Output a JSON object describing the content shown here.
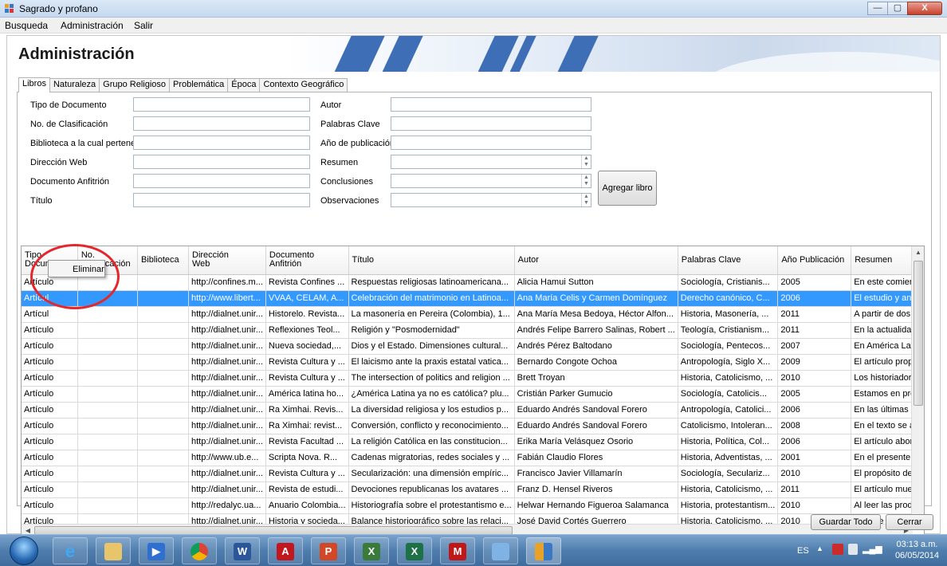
{
  "window": {
    "title": "Sagrado y profano",
    "controls": [
      "—",
      "▢",
      "X"
    ]
  },
  "menu": [
    "Busqueda",
    "Administración",
    "Salir"
  ],
  "page": {
    "heading": "Administración"
  },
  "tabs": [
    "Libros",
    "Naturaleza",
    "Grupo Religioso",
    "Problemática",
    "Época",
    "Contexto Geográfico"
  ],
  "form": {
    "left_labels": [
      "Tipo de Documento",
      "No. de Clasificación",
      "Biblioteca a la cual pertenece",
      "Dirección Web",
      "Documento Anfitrión",
      "Título"
    ],
    "right_labels": [
      "Autor",
      "Palabras Clave",
      "Año de publicación",
      "Resumen",
      "Conclusiones",
      "Observaciones"
    ],
    "add_button": "Agregar libro"
  },
  "grid": {
    "columns": [
      "Tipo\nDocumento",
      "No.\nClasificación",
      "Biblioteca",
      "Dirección\nWeb",
      "Documento\nAnfitrión",
      "Título",
      "Autor",
      "Palabras Clave",
      "Año Publicación",
      "Resumen"
    ],
    "rows": [
      [
        "Artículo",
        "",
        "",
        "http://confines.m...",
        "Revista Confines ...",
        "Respuestas religiosas latinoamericana...",
        "Alicia Hamui Sutton",
        "Sociología, Cristianis...",
        "2005",
        "En este comienz"
      ],
      [
        "Artícul",
        "",
        "",
        "http://www.libert...",
        "VVAA, CELAM, A...",
        "Celebración del matrimonio en Latinoa...",
        "Ana María Celis y Carmen Domínguez",
        "Derecho canónico, C...",
        "2006",
        "El estudio y aná"
      ],
      [
        "Artícul",
        "",
        "",
        "http://dialnet.unir...",
        "Historelo. Revista...",
        "La masonería en Pereira (Colombia), 1...",
        "Ana María Mesa Bedoya, Héctor Alfon...",
        "Historia, Masonería, ...",
        "2011",
        "A partir de dos v"
      ],
      [
        "Artículo",
        "",
        "",
        "http://dialnet.unir...",
        "Reflexiones Teol...",
        "Religión y \"Posmodernidad\"",
        "Andrés Felipe Barrero Salinas, Robert ...",
        "Teología, Cristianism...",
        "2011",
        "En la actualidad"
      ],
      [
        "Artículo",
        "",
        "",
        "http://dialnet.unir...",
        "Nueva sociedad,...",
        "Dios y el Estado. Dimensiones cultural...",
        "Andrés Pérez Baltodano",
        "Sociología, Pentecos...",
        "2007",
        "En América Lati"
      ],
      [
        "Artículo",
        "",
        "",
        "http://dialnet.unir...",
        "Revista Cultura y ...",
        "El laicismo ante la praxis estatal vatica...",
        "Bernardo Congote Ochoa",
        "Antropología, Siglo X...",
        "2009",
        "El artículo propc"
      ],
      [
        "Artículo",
        "",
        "",
        "http://dialnet.unir...",
        "Revista Cultura y ...",
        "The intersection of politics and religion ...",
        "Brett Troyan",
        "Historia, Catolicismo, ...",
        "2010",
        "Los historiadore:"
      ],
      [
        "Artículo",
        "",
        "",
        "http://dialnet.unir...",
        "América latina ho...",
        "¿América Latina ya no es católica? plu...",
        "Cristián Parker Gumucio",
        "Sociología, Catolicis...",
        "2005",
        "Estamos en pres"
      ],
      [
        "Artículo",
        "",
        "",
        "http://dialnet.unir...",
        "Ra Ximhai. Revis...",
        "La diversidad religiosa y los estudios p...",
        "Eduardo Andrés Sandoval Forero",
        "Antropología, Catolici...",
        "2006",
        "En las últimas de"
      ],
      [
        "Artículo",
        "",
        "",
        "http://dialnet.unir...",
        "Ra Ximhai: revist...",
        "Conversión, conflicto y reconocimiento...",
        "Eduardo Andrés Sandoval Forero",
        "Catolicismo, Intoleran...",
        "2008",
        "En el texto se al"
      ],
      [
        "Artículo",
        "",
        "",
        "http://dialnet.unir...",
        "Revista Facultad ...",
        "La religión Católica en las constitucion...",
        "Erika María Velásquez Osorio",
        "Historia, Política, Col...",
        "2006",
        "El artículo aborc"
      ],
      [
        "Artículo",
        "",
        "",
        "http://www.ub.e...",
        "Scripta Nova. R...",
        "Cadenas migratorias, redes sociales y ...",
        "Fabián Claudio Flores",
        "Historia, Adventistas, ...",
        "2001",
        "En el presente ti"
      ],
      [
        "Artículo",
        "",
        "",
        "http://dialnet.unir...",
        "Revista Cultura y ...",
        "Secularización: una dimensión empíric...",
        "Francisco Javier Villamarín",
        "Sociología, Seculariz...",
        "2010",
        "El propósito de e"
      ],
      [
        "Artículo",
        "",
        "",
        "http://dialnet.unir...",
        "Revista de estudi...",
        "Devociones republicanas los avatares ...",
        "Franz D. Hensel Riveros",
        "Historia, Catolicismo, ...",
        "2011",
        "El artículo mues"
      ],
      [
        "Artículo",
        "",
        "",
        "http://redalyc.ua...",
        "Anuario Colombia...",
        "Historiografía sobre el protestantismo e...",
        "Helwar Hernando Figueroa Salamanca",
        "Historia, protestantism...",
        "2010",
        "Al leer las produ"
      ],
      [
        "Artículo",
        "",
        "",
        "http://dialnet.unir...",
        "Historia y socieda...",
        "Balance historiográfico sobre las relaci...",
        "José David Cortés Guerrero",
        "Historia, Catolicismo, ...",
        "2010",
        "En este artículo"
      ]
    ],
    "selected_row": 1
  },
  "context_menu": {
    "item": "Eliminar"
  },
  "footer": {
    "save_all": "Guardar Todo",
    "close": "Cerrar"
  },
  "taskbar": {
    "language": "ES",
    "time": "03:13 a.m.",
    "date": "06/05/2014",
    "icons": [
      "ie-icon",
      "explorer-icon",
      "media-player-icon",
      "chrome-icon",
      "word-icon",
      "acrobat-icon",
      "powerpoint-icon",
      "visio-icon",
      "excel-icon",
      "mcafee-icon",
      "paint-icon",
      "app-icon"
    ]
  },
  "colors": {
    "selection": "#3399ff",
    "annotation": "#e5272b",
    "taskbar": "#4f7eae"
  }
}
